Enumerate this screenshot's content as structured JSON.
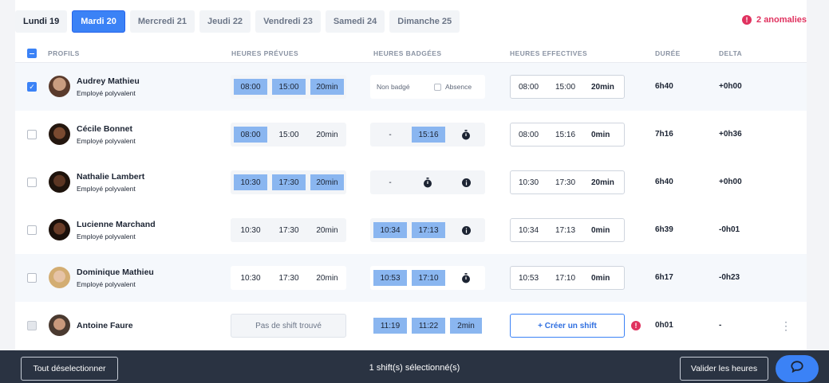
{
  "days": [
    "Lundi 19",
    "Mardi 20",
    "Mercredi 21",
    "Jeudi 22",
    "Vendredi 23",
    "Samedi 24",
    "Dimanche 25"
  ],
  "active_day_index": 1,
  "anomalies": {
    "icon": "alert-icon",
    "label": "2 anomalies"
  },
  "headers": {
    "profils": "PROFILS",
    "prevues": "HEURES PRÉVUES",
    "badgees": "HEURES BADGÉES",
    "effectives": "HEURES EFFECTIVES",
    "duree": "DURÉE",
    "delta": "DELTA"
  },
  "rows": [
    {
      "name": "Audrey Mathieu",
      "role": "Employé polyvalent",
      "checked": true,
      "prevues": [
        "08:00",
        "15:00",
        "20min"
      ],
      "badgees": {
        "non_badge": "Non badgé",
        "absence": "Absence"
      },
      "effectives": [
        "08:00",
        "15:00",
        "20min"
      ],
      "duree": "6h40",
      "delta": "+0h00"
    },
    {
      "name": "Cécile Bonnet",
      "role": "Employé polyvalent",
      "checked": false,
      "prevues": [
        "08:00",
        "15:00",
        "20min"
      ],
      "badgees": {
        "start": "-",
        "end": "15:16",
        "icon": "stopwatch-icon"
      },
      "effectives": [
        "08:00",
        "15:16",
        "0min"
      ],
      "duree": "7h16",
      "delta": "+0h36"
    },
    {
      "name": "Nathalie Lambert",
      "role": "Employé polyvalent",
      "checked": false,
      "prevues": [
        "10:30",
        "17:30",
        "20min"
      ],
      "badgees": {
        "start": "-",
        "icon1": "stopwatch-icon",
        "icon2": "info-icon"
      },
      "effectives": [
        "10:30",
        "17:30",
        "20min"
      ],
      "duree": "6h40",
      "delta": "+0h00"
    },
    {
      "name": "Lucienne Marchand",
      "role": "Employé polyvalent",
      "checked": false,
      "prevues": [
        "10:30",
        "17:30",
        "20min"
      ],
      "badgees": {
        "start": "10:34",
        "end": "17:13",
        "icon": "info-icon"
      },
      "effectives": [
        "10:34",
        "17:13",
        "0min"
      ],
      "duree": "6h39",
      "delta": "-0h01"
    },
    {
      "name": "Dominique Mathieu",
      "role": "Employé polyvalent",
      "checked": false,
      "prevues": [
        "10:30",
        "17:30",
        "20min"
      ],
      "badgees": {
        "start": "10:53",
        "end": "17:10",
        "icon": "stopwatch-icon"
      },
      "effectives": [
        "10:53",
        "17:10",
        "0min"
      ],
      "duree": "6h17",
      "delta": "-0h23"
    },
    {
      "name": "Antoine Faure",
      "role": "",
      "checked": false,
      "no_shift": "Pas de shift trouvé",
      "badgees": {
        "start": "11:19",
        "end": "11:22",
        "pause": "2min"
      },
      "create_shift": "+ Créer un shift",
      "duree": "0h01",
      "delta": "-"
    }
  ],
  "footer": {
    "deselect": "Tout déselectionner",
    "selected": "1 shift(s) sélectionné(s)",
    "validate": "Valider les heures",
    "chat_icon": "chat-icon"
  },
  "colors": {
    "accent": "#3b82f6",
    "highlight": "#8ab6f0",
    "danger": "#e0325f",
    "footer": "#2a3342"
  }
}
